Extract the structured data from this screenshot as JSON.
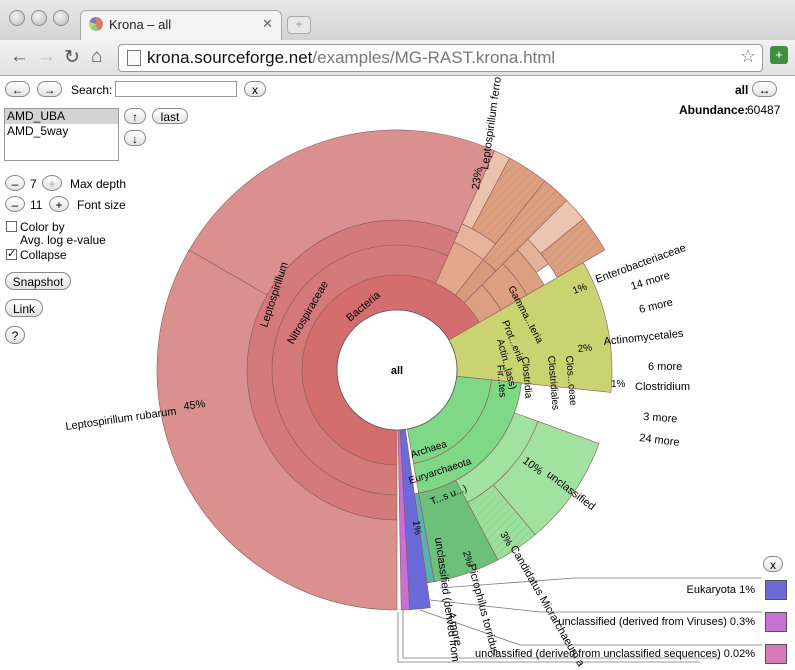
{
  "browser": {
    "tab_title": "Krona – all",
    "tab_close": "✕",
    "new_tab": "+",
    "url_host": "krona.sourceforge.net",
    "url_path": "/examples/MG-RAST.krona.html"
  },
  "controls": {
    "back": "←",
    "forward": "→",
    "search_label": "Search:",
    "search_value": "",
    "search_clear": "x",
    "datasets": [
      "AMD_UBA",
      "AMD_5way"
    ],
    "dataset_selected": "AMD_UBA",
    "up": "↑",
    "down": "↓",
    "last": "last",
    "max_depth_value": "7",
    "max_depth_label": "Max depth",
    "font_size_value": "11",
    "font_size_label": "Font size",
    "minus": "–",
    "plus": "+",
    "color_by_label_1": "Color by",
    "color_by_label_2": "Avg. log e-value",
    "color_by_checked": false,
    "collapse_label": "Collapse",
    "collapse_checked": true,
    "snapshot": "Snapshot",
    "link": "Link",
    "help": "?"
  },
  "header": {
    "current_node": "all",
    "expand_icon": "↔",
    "abundance_label": "Abundance:",
    "abundance_value": "60487"
  },
  "chart": {
    "center_label": "all",
    "labels": {
      "bacteria": "Bacteria",
      "nitrospiraceae": "Nitrospiraceae",
      "leptospirillum": "Leptospirillum",
      "l_rubarum": "Leptospirillum rubarum",
      "l_rubarum_pct": "45%",
      "l_ferro": "Leptospirillum ferro",
      "l_ferro_pct": "23%",
      "gamma": "Gamma...teria",
      "proteo": "Prot...eria",
      "actino": "Actin...lass)",
      "firm": "Fir...tes",
      "clostridia": "Clostridia",
      "clostridiales": "Clostridiales",
      "clos": "Clos...ceae",
      "enterobacteriaceae": "Enterobacteriaceae",
      "ent_pct": "1%",
      "m14": "14 more",
      "m6a": "6 more",
      "actinomycetales": "Actinomycetales",
      "act_pct": "2%",
      "m6b": "6 more",
      "clostridium": "Clostridium",
      "clo_pct": "1%",
      "m3": "3 more",
      "m24": "24 more",
      "unclassified": "unclassified",
      "unc_pct": "10%",
      "archaea": "Archaea",
      "euryarchaeota": "Euryarchaeota",
      "tsu": "T...s u...)",
      "micrarchaeum": "Candidatus Micrarchaeum a",
      "mic_pct": "3%",
      "picrophilus": "Picrophilus torridus",
      "pic_pct": "2%",
      "unc_derived": "unclassified (derived from",
      "ud_pct": "1%",
      "m4": "4 more"
    }
  },
  "legend": {
    "close": "x",
    "items": [
      {
        "label": "Eukaryota",
        "pct": "1%",
        "color": "#6a6ad8"
      },
      {
        "label": "unclassified (derived from Viruses)",
        "pct": "0.3%",
        "color": "#c86fd8"
      },
      {
        "label": "unclassified (derived from unclassified sequences)",
        "pct": "0.02%",
        "color": "#d879b9"
      }
    ]
  },
  "colors": {
    "bacteria_core": "#d46e6e",
    "bacteria_mid": "#d57a7a",
    "lepto": "#db9090",
    "gamma": "#e7b49b",
    "firm": "#dca080",
    "unclassified": "#cbd271",
    "archaea": "#7fd886",
    "archaea_light": "#a1e2a1",
    "eukaryota": "#6a6ad8",
    "viruses": "#c86fd8"
  }
}
